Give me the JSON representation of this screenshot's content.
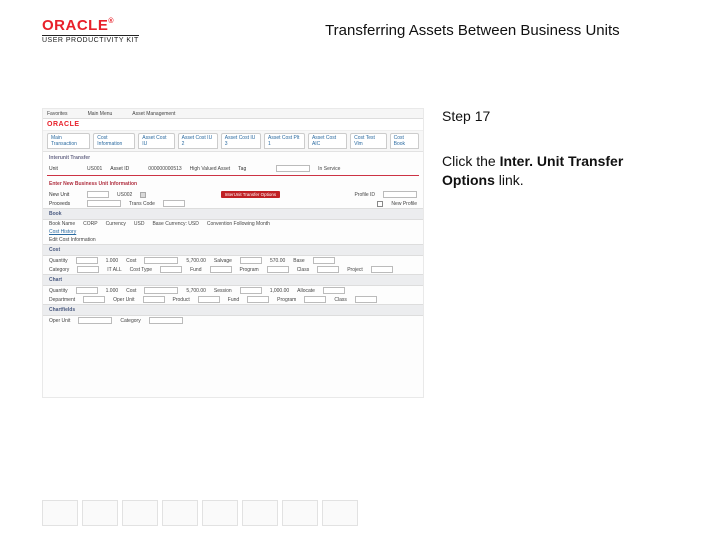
{
  "header": {
    "brand": "ORACLE",
    "brand_sub": "USER PRODUCTIVITY KIT",
    "title": "Transferring Assets Between Business Units"
  },
  "right": {
    "step_label": "Step 17",
    "instr_prefix": "Click the ",
    "instr_bold": "Inter. Unit Transfer Options",
    "instr_suffix": " link."
  },
  "mock": {
    "brand": "ORACLE",
    "tabs": [
      "Main Transaction",
      "Cost Information",
      "Asset Cost IU",
      "Asset Cost IU 2",
      "Asset Cost IU 3",
      "Asset Cost Plt 1",
      "Asset Cost AIC",
      "Cost Test Vlm",
      "Cost Book"
    ],
    "section1": "Interunit Transfer",
    "row1": {
      "unit": "Unit",
      "unit_v": "US001",
      "asset": "Asset ID",
      "asset_v": "000000000513",
      "highval": "High Valued Asset",
      "tag": "Tag",
      "trans": "In Service"
    },
    "section2": "Enter New Business Unit Information",
    "row2a": {
      "nbu": "New Unit",
      "nbu_v": "US002",
      "iu": "InterUnit Transfer Options",
      "profile": "Profile ID"
    },
    "row2b": {
      "proceeds": "Proceeds",
      "transcode": "Trans Code",
      "newprof": "New Profile"
    },
    "bar_book": "Book",
    "book_row": {
      "bookname": "Book Name",
      "corp": "CORP",
      "cur": "Currency",
      "usd": "USD",
      "baserate": "Base Currency: USD",
      "conv": "Convention Following Month"
    },
    "cost_history": "Cost History",
    "edit_cost": "Edit Cost Information",
    "bar_cost": "Cost",
    "cost_row": {
      "qty": "Quantity",
      "qty_v": "1.000",
      "cost": "Cost",
      "cost_v": "5,700.00",
      "sal": "Salvage",
      "sal_v": "570.00",
      "base": "Base"
    },
    "cost_row2": {
      "cat": "Category",
      "cat_v": "IT ALL",
      "type": "Cost Type",
      "fund": "Fund",
      "prog": "Program",
      "class": "Class",
      "proj": "Project"
    },
    "bar_chart": "Chart",
    "ch_row": {
      "qty": "Quantity",
      "qty_v": "1.000",
      "cost": "Cost",
      "cost_v": "5,700.00",
      "sess": "Session",
      "sess_v": "1,000.00",
      "al": "Allocate"
    },
    "ch_row2": {
      "dept": "Department",
      "oper": "Oper Unit",
      "prod": "Product",
      "fund": "Fund",
      "prog": "Program",
      "class": "Class"
    },
    "bar_chart2": "Chartfields",
    "cf_row": {
      "oper": "Oper Unit",
      "cat": "Category"
    }
  }
}
